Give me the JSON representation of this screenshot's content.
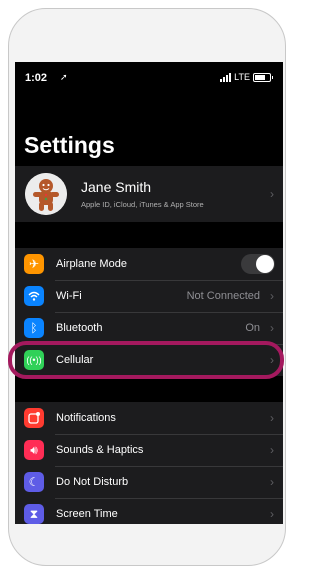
{
  "status_bar": {
    "time": "1:02",
    "network": "LTE"
  },
  "page_title": "Settings",
  "profile": {
    "name": "Jane Smith",
    "subtitle": "Apple ID, iCloud, iTunes & App Store"
  },
  "group1": [
    {
      "label": "Airplane Mode",
      "icon": "airplane-icon",
      "color": "#ff9500",
      "toggle": false
    },
    {
      "label": "Wi-Fi",
      "icon": "wifi-icon",
      "color": "#0a84ff",
      "value": "Not Connected"
    },
    {
      "label": "Bluetooth",
      "icon": "bluetooth-icon",
      "color": "#0a84ff",
      "value": "On"
    },
    {
      "label": "Cellular",
      "icon": "cellular-icon",
      "color": "#30d158"
    }
  ],
  "group2": [
    {
      "label": "Notifications",
      "icon": "notifications-icon",
      "color": "#ff3b30"
    },
    {
      "label": "Sounds & Haptics",
      "icon": "sounds-icon",
      "color": "#ff2d55"
    },
    {
      "label": "Do Not Disturb",
      "icon": "moon-icon",
      "color": "#5e5ce6"
    },
    {
      "label": "Screen Time",
      "icon": "hourglass-icon",
      "color": "#5e5ce6"
    }
  ],
  "highlight_color": "#a4195e"
}
